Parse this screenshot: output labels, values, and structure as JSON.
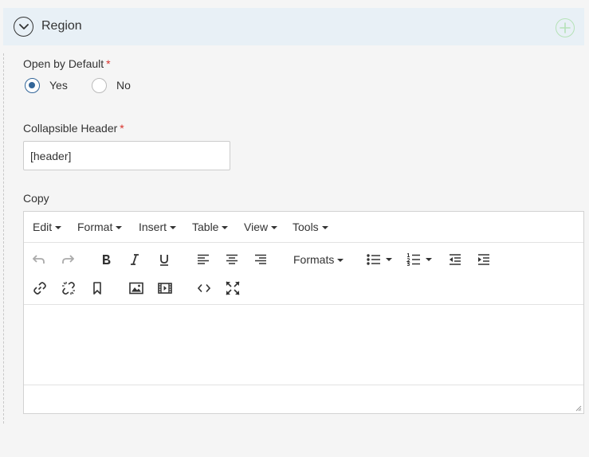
{
  "region": {
    "title": "Region"
  },
  "open_default": {
    "label": "Open by Default",
    "required_mark": "*",
    "options": [
      {
        "label": "Yes",
        "selected": true
      },
      {
        "label": "No",
        "selected": false
      }
    ]
  },
  "collapsible_header": {
    "label": "Collapsible Header",
    "required_mark": "*",
    "value": "[header]"
  },
  "copy": {
    "label": "Copy",
    "menu": [
      "Edit",
      "Format",
      "Insert",
      "Table",
      "View",
      "Tools"
    ],
    "formats_label": "Formats"
  },
  "colors": {
    "header_bg": "#e8f0f6",
    "required": "#d9312b",
    "radio_accent": "#336699",
    "add_icon": "#b5e2b7"
  }
}
